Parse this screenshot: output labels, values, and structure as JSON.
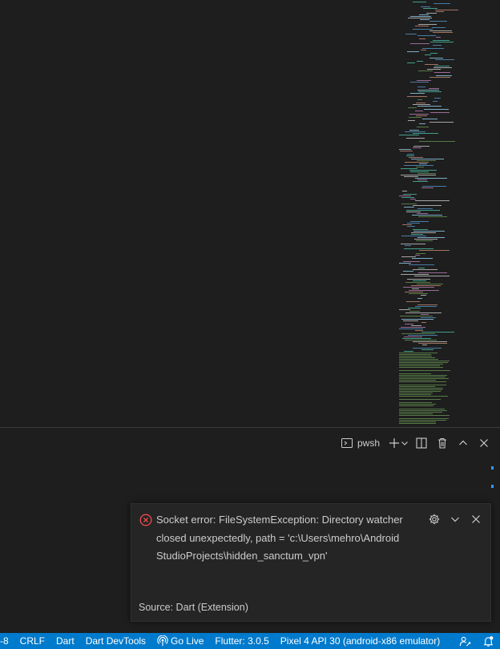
{
  "panel": {
    "terminal_shell_label": "pwsh"
  },
  "notification": {
    "message": "Socket error: FileSystemException: Directory watcher closed unexpectedly, path = 'c:\\Users\\mehro\\AndroidStudioProjects\\hidden_sanctum_vpn'",
    "source": "Source: Dart (Extension)"
  },
  "statusbar": {
    "encoding": "-8",
    "eol": "CRLF",
    "language": "Dart",
    "devtools": "Dart DevTools",
    "go_live": "Go Live",
    "flutter": "Flutter: 3.0.5",
    "device": "Pixel 4 API 30 (android-x86 emulator)"
  },
  "colors": {
    "statusbar_bg": "#007acc",
    "error_icon": "#f14c4c",
    "toast_bg": "#252526",
    "editor_bg": "#1e1e1e"
  }
}
